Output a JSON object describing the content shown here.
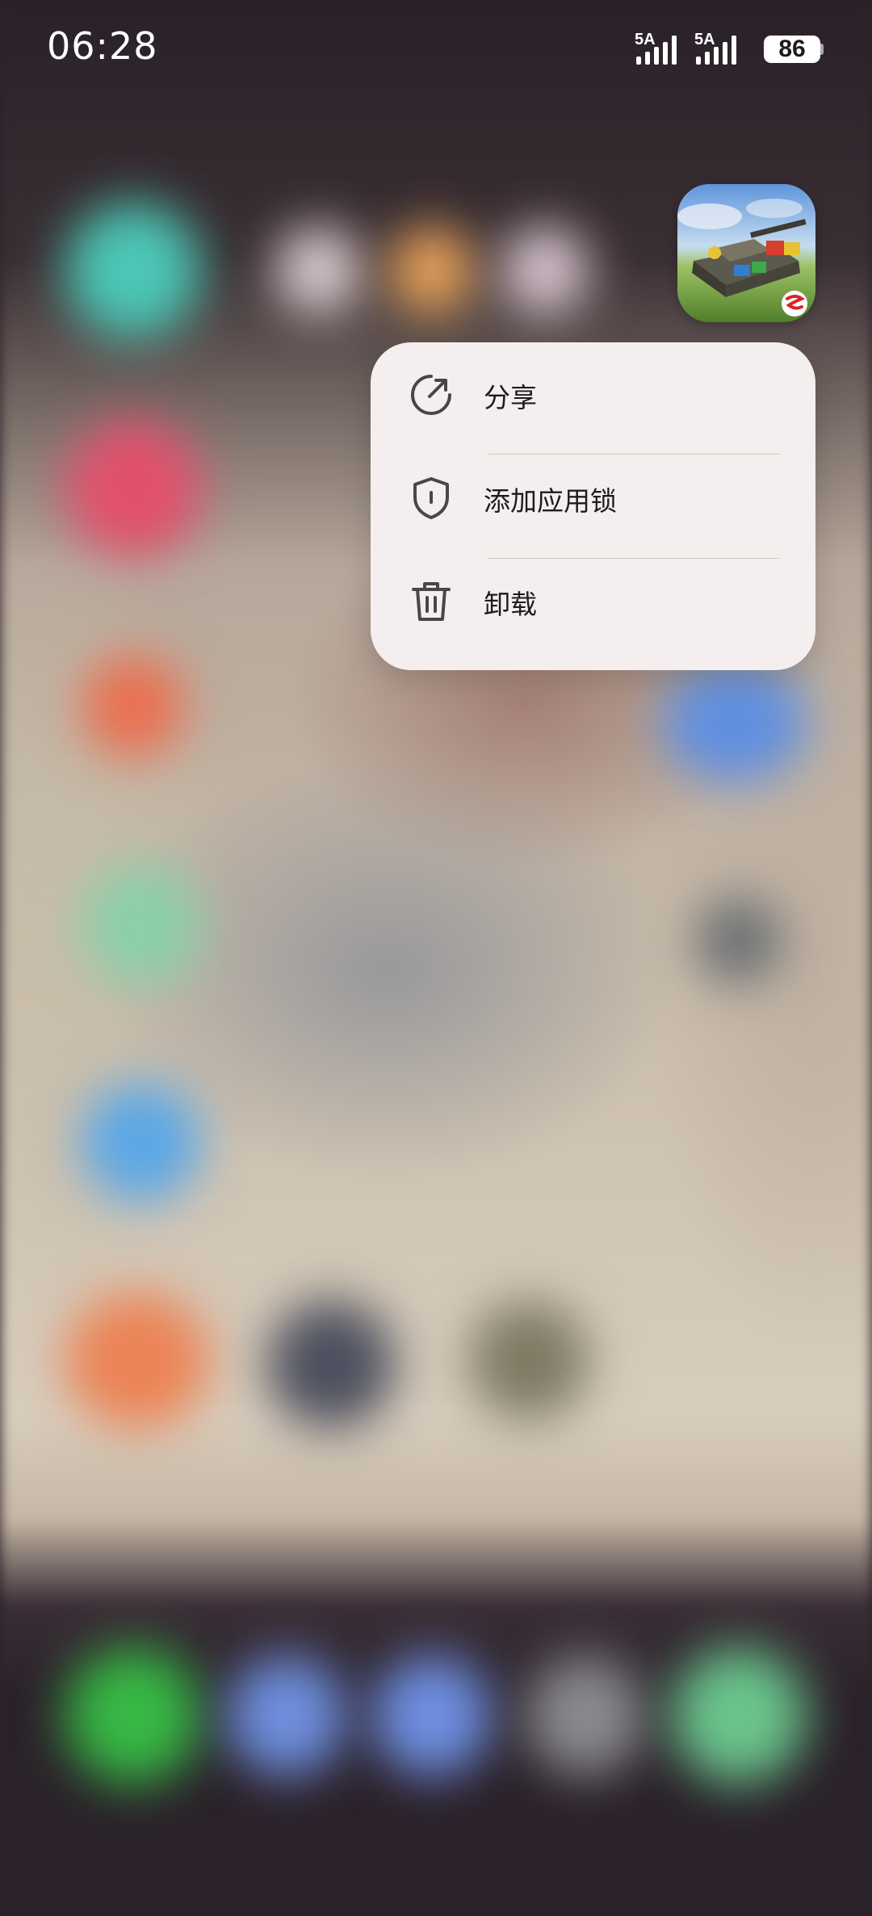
{
  "status_bar": {
    "time": "06:28",
    "sim1_network": "5A",
    "sim2_network": "5A",
    "battery_level": "86"
  },
  "app": {
    "icon_name": "tank-game-app-icon"
  },
  "context_menu": {
    "items": [
      {
        "label": "分享",
        "icon": "share-icon"
      },
      {
        "label": "添加应用锁",
        "icon": "shield-lock-icon"
      },
      {
        "label": "卸载",
        "icon": "trash-icon"
      }
    ]
  },
  "colors": {
    "menu_background": "#f4efee",
    "menu_text": "#1f1b1d",
    "icon_stroke": "#4a4547"
  }
}
